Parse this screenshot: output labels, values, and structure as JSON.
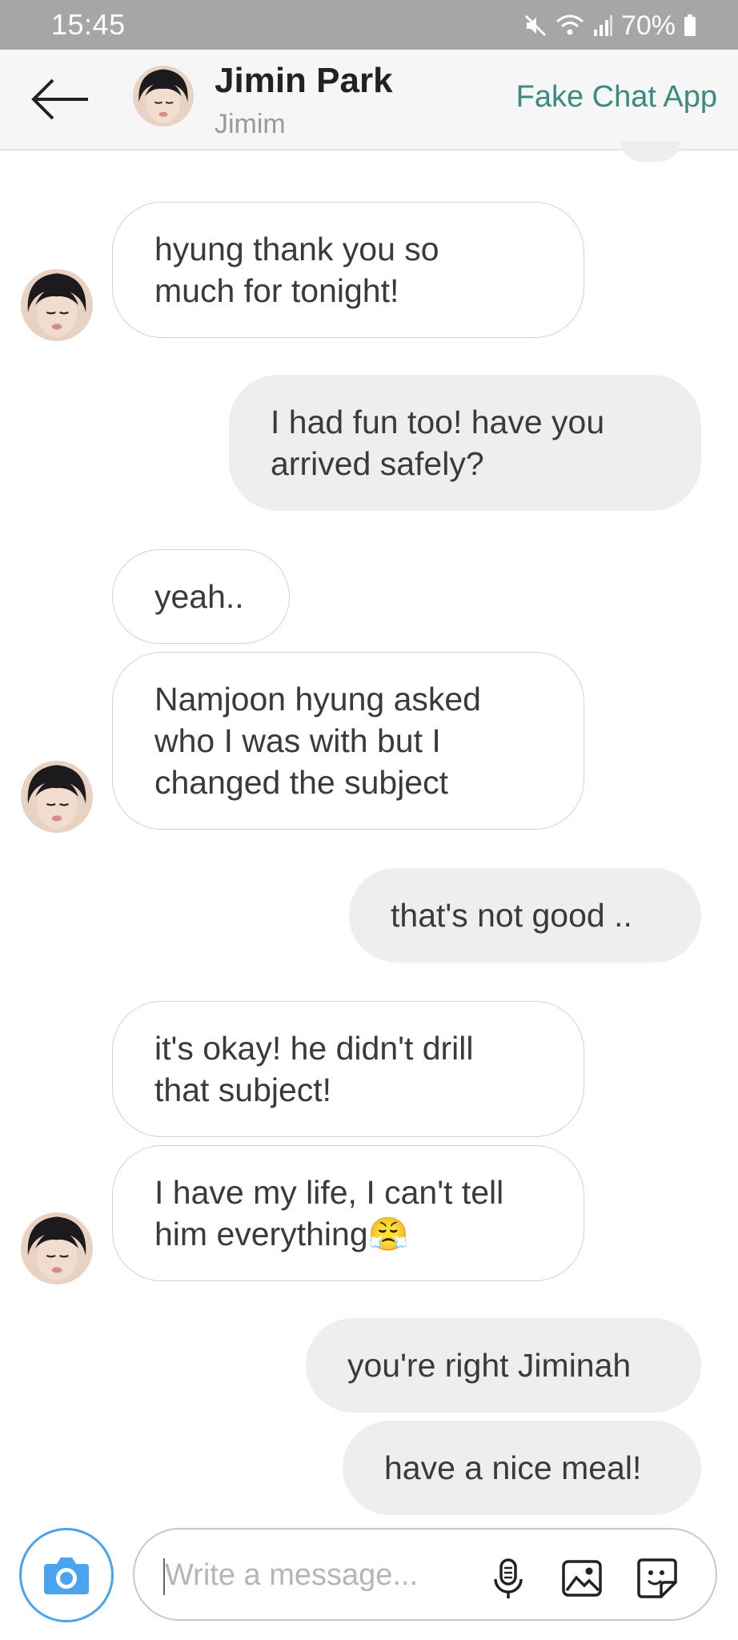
{
  "status_bar": {
    "time": "15:45",
    "battery": "70%"
  },
  "header": {
    "contact_name": "Jimin Park",
    "contact_subtitle": "Jimim",
    "app_name": "Fake Chat App"
  },
  "messages": [
    {
      "from": "contact",
      "text_lines": [
        "hyung thank you so",
        "much for tonight!"
      ]
    },
    {
      "from": "me",
      "text_lines": [
        "I had fun too! have you",
        "arrived safely?"
      ]
    },
    {
      "from": "contact",
      "text_lines": [
        "yeah.."
      ]
    },
    {
      "from": "contact",
      "text_lines": [
        "Namjoon hyung asked",
        "who I was with but I",
        "changed the subject"
      ]
    },
    {
      "from": "me",
      "text_lines": [
        "that's not good .."
      ]
    },
    {
      "from": "contact",
      "text_lines": [
        "it's okay! he didn't drill",
        "that subject!"
      ]
    },
    {
      "from": "contact",
      "text_lines": [
        "I have my life, I can't tell",
        "him everything"
      ],
      "emoji": "😤"
    },
    {
      "from": "me",
      "text_lines": [
        "you're right Jiminah"
      ]
    },
    {
      "from": "me",
      "text_lines": [
        "have a nice meal!"
      ]
    }
  ],
  "composer": {
    "placeholder": "Write a message..."
  },
  "icons": {
    "back": "arrow-left-icon",
    "camera": "camera-icon",
    "mic": "microphone-icon",
    "gallery": "image-icon",
    "sticker": "sticker-icon"
  },
  "colors": {
    "accent": "#3b8a80",
    "camera_blue": "#4aa3ee",
    "sent_bubble": "#eeeeee",
    "status_bar": "#a6a6a6"
  }
}
